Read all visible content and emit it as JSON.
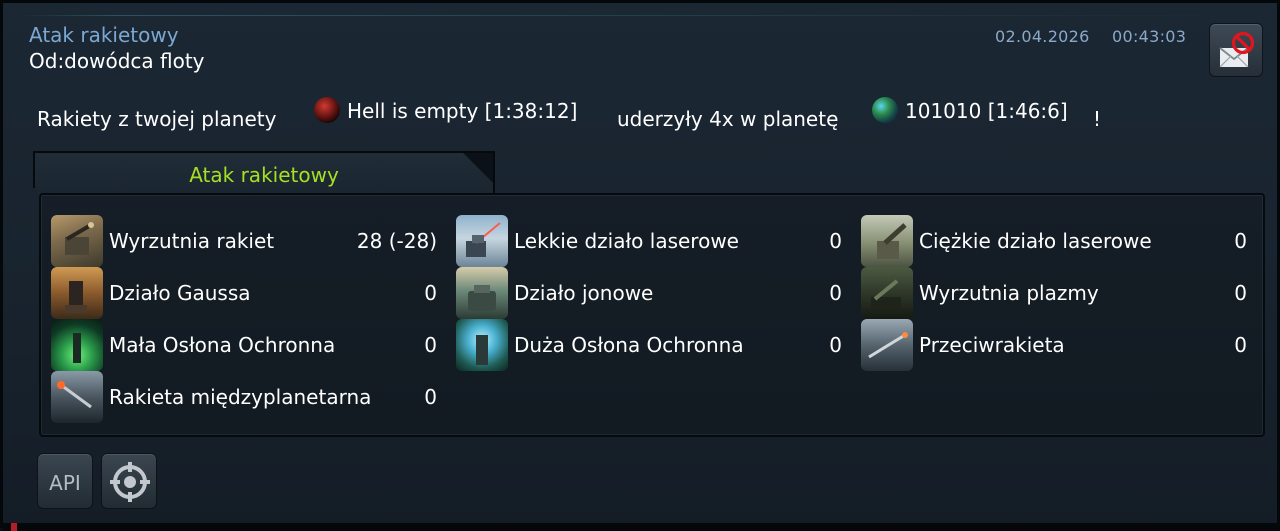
{
  "message": {
    "subject": "Atak rakietowy",
    "from": "Od:dowódca floty",
    "date": "02.04.2026",
    "time": "00:43:03",
    "delete_icon": "envelope-delete-icon"
  },
  "body": {
    "text_before": "Rakiety z twojej planety",
    "origin_planet": "Hell is empty [1:38:12]",
    "text_middle": "uderzyły 4x w planetę",
    "target_planet": "101010 [1:46:6]",
    "text_end": "!"
  },
  "tab": {
    "label": "Atak rakietowy"
  },
  "units": [
    {
      "name": "Wyrzutnia rakiet",
      "count": "28 (-28)",
      "icon": "rocket-launcher-icon"
    },
    {
      "name": "Lekkie działo laserowe",
      "count": "0",
      "icon": "light-laser-icon"
    },
    {
      "name": "Ciężkie działo laserowe",
      "count": "0",
      "icon": "heavy-laser-icon"
    },
    {
      "name": "Działo Gaussa",
      "count": "0",
      "icon": "gauss-cannon-icon"
    },
    {
      "name": "Działo jonowe",
      "count": "0",
      "icon": "ion-cannon-icon"
    },
    {
      "name": "Wyrzutnia plazmy",
      "count": "0",
      "icon": "plasma-turret-icon"
    },
    {
      "name": "Mała Osłona Ochronna",
      "count": "0",
      "icon": "small-shield-dome-icon"
    },
    {
      "name": "Duża Osłona Ochronna",
      "count": "0",
      "icon": "large-shield-dome-icon"
    },
    {
      "name": "Przeciwrakieta",
      "count": "0",
      "icon": "anti-ballistic-missile-icon"
    },
    {
      "name": "Rakieta międzyplanetarna",
      "count": "0",
      "icon": "interplanetary-missile-icon"
    }
  ],
  "footer": {
    "api_label": "API",
    "target_icon": "crosshair-icon"
  },
  "colors": {
    "subject": "#7aa8d2",
    "date": "#8aa9c9",
    "tab_label": "#a6e024",
    "text": "#ffffff"
  }
}
